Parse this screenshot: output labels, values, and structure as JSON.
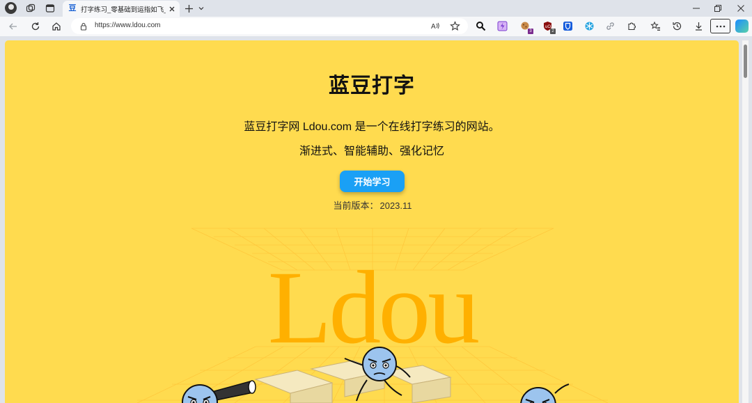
{
  "browser": {
    "tab": {
      "favicon": "豆",
      "title": "打字练习_零基础到运指如飞_蓝豆打字"
    },
    "address": {
      "url": "https://www.ldou.com"
    },
    "extensions": [
      {
        "name": "search-extension-icon",
        "badge": ""
      },
      {
        "name": "purple-extension-icon",
        "badge": ""
      },
      {
        "name": "cookie-extension-icon",
        "badge": "3"
      },
      {
        "name": "ublock-extension-icon",
        "badge": "2"
      },
      {
        "name": "bitwarden-extension-icon",
        "badge": ""
      },
      {
        "name": "snowflake-extension-icon",
        "badge": ""
      },
      {
        "name": "link-extension-icon",
        "badge": ""
      }
    ],
    "colors": {
      "chrome": "#dfe3ea",
      "toolbar": "#f6f7f9"
    }
  },
  "page": {
    "title": "蓝豆打字",
    "description": "蓝豆打字网 Ldou.com 是一个在线打字练习的网站。",
    "tagline": "渐进式、智能辅助、强化记忆",
    "start_button": "开始学习",
    "version_label": "当前版本：",
    "version_value": "2023.11",
    "hero_logo_text": "Ldou",
    "colors": {
      "background": "#ffdb4f",
      "button": "#1aa0f5",
      "logo": "#ffb000"
    }
  }
}
